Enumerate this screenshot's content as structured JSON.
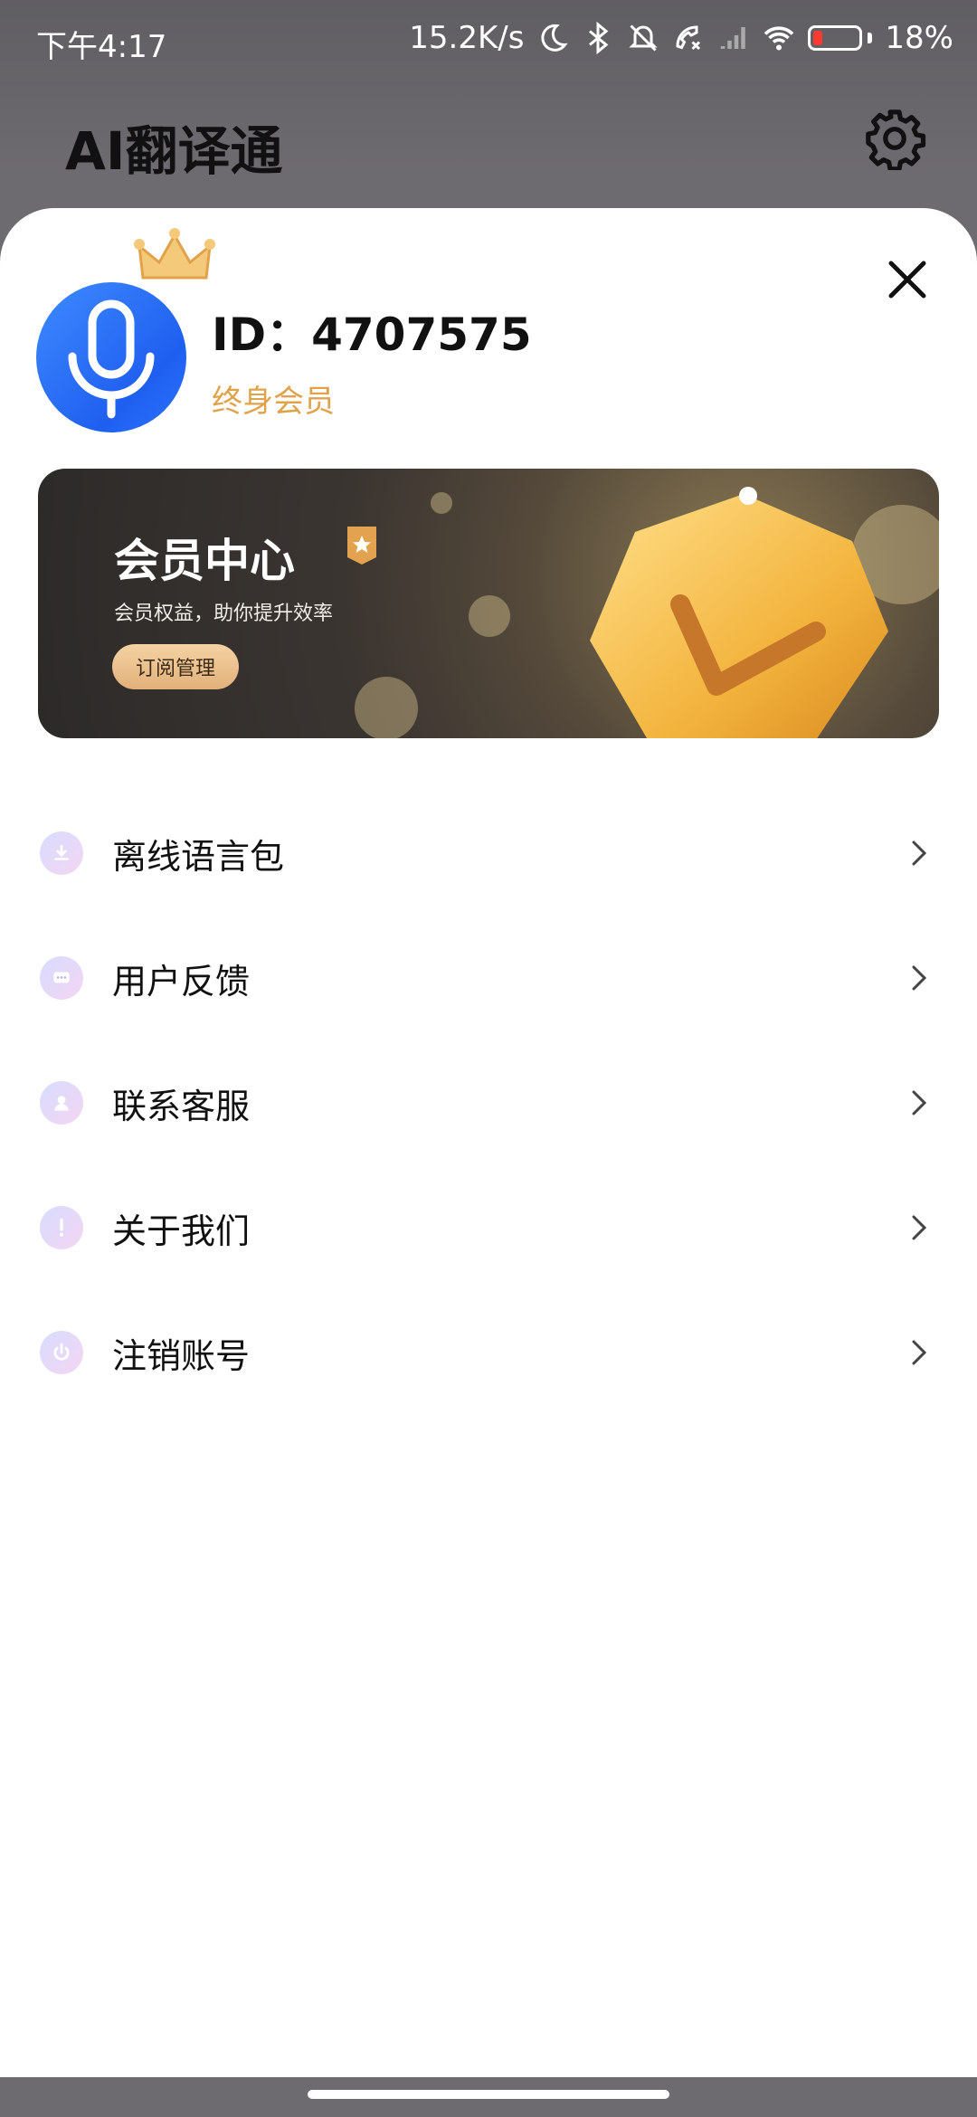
{
  "status_bar": {
    "time": "下午4:17",
    "network_speed": "15.2K/s",
    "battery_percent": "18%",
    "icons": [
      "moon-icon",
      "bluetooth-icon",
      "mute-icon",
      "call-icon",
      "signal-icon",
      "wifi-icon",
      "battery-icon"
    ]
  },
  "app": {
    "title": "AI翻译通",
    "settings_icon": "gear-icon"
  },
  "profile": {
    "id_text": "ID：4707575",
    "member_type": "终身会员",
    "avatar_icon": "microphone-icon"
  },
  "banner": {
    "title": "会员中心",
    "subtitle": "会员权益，助你提升效率",
    "button_label": "订阅管理"
  },
  "menu": {
    "items": [
      {
        "label": "离线语言包",
        "icon": "download-icon"
      },
      {
        "label": "用户反馈",
        "icon": "chat-icon"
      },
      {
        "label": "联系客服",
        "icon": "person-icon"
      },
      {
        "label": "关于我们",
        "icon": "info-icon"
      },
      {
        "label": "注销账号",
        "icon": "power-icon"
      }
    ]
  },
  "colors": {
    "accent_blue": "#2c6ff5",
    "member_gold": "#e0a24a",
    "backdrop": "#6e6b70"
  }
}
